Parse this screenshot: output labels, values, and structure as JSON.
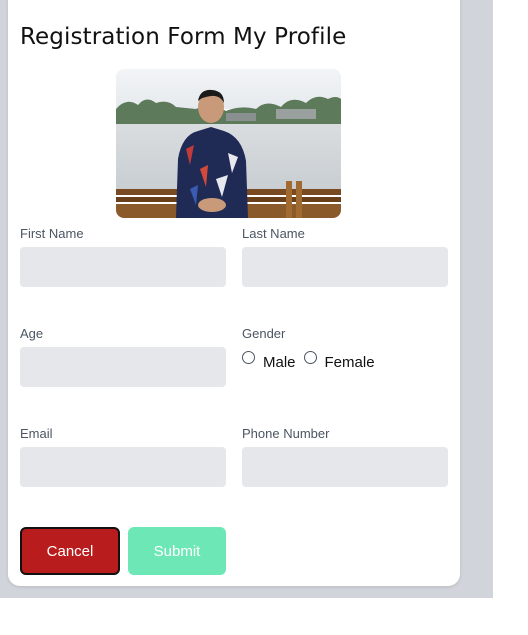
{
  "form": {
    "title": "Registration Form My Profile",
    "fields": {
      "first_name": {
        "label": "First Name",
        "value": ""
      },
      "last_name": {
        "label": "Last Name",
        "value": ""
      },
      "age": {
        "label": "Age",
        "value": ""
      },
      "gender": {
        "label": "Gender",
        "options": [
          "Male",
          "Female"
        ]
      },
      "email": {
        "label": "Email",
        "value": ""
      },
      "phone": {
        "label": "Phone Number",
        "value": ""
      }
    },
    "buttons": {
      "cancel": "Cancel",
      "submit": "Submit"
    }
  },
  "colors": {
    "cancel_bg": "#b91c1c",
    "submit_bg": "#6ee7b7",
    "field_bg": "#e5e7eb",
    "page_bg": "#d1d5db"
  }
}
